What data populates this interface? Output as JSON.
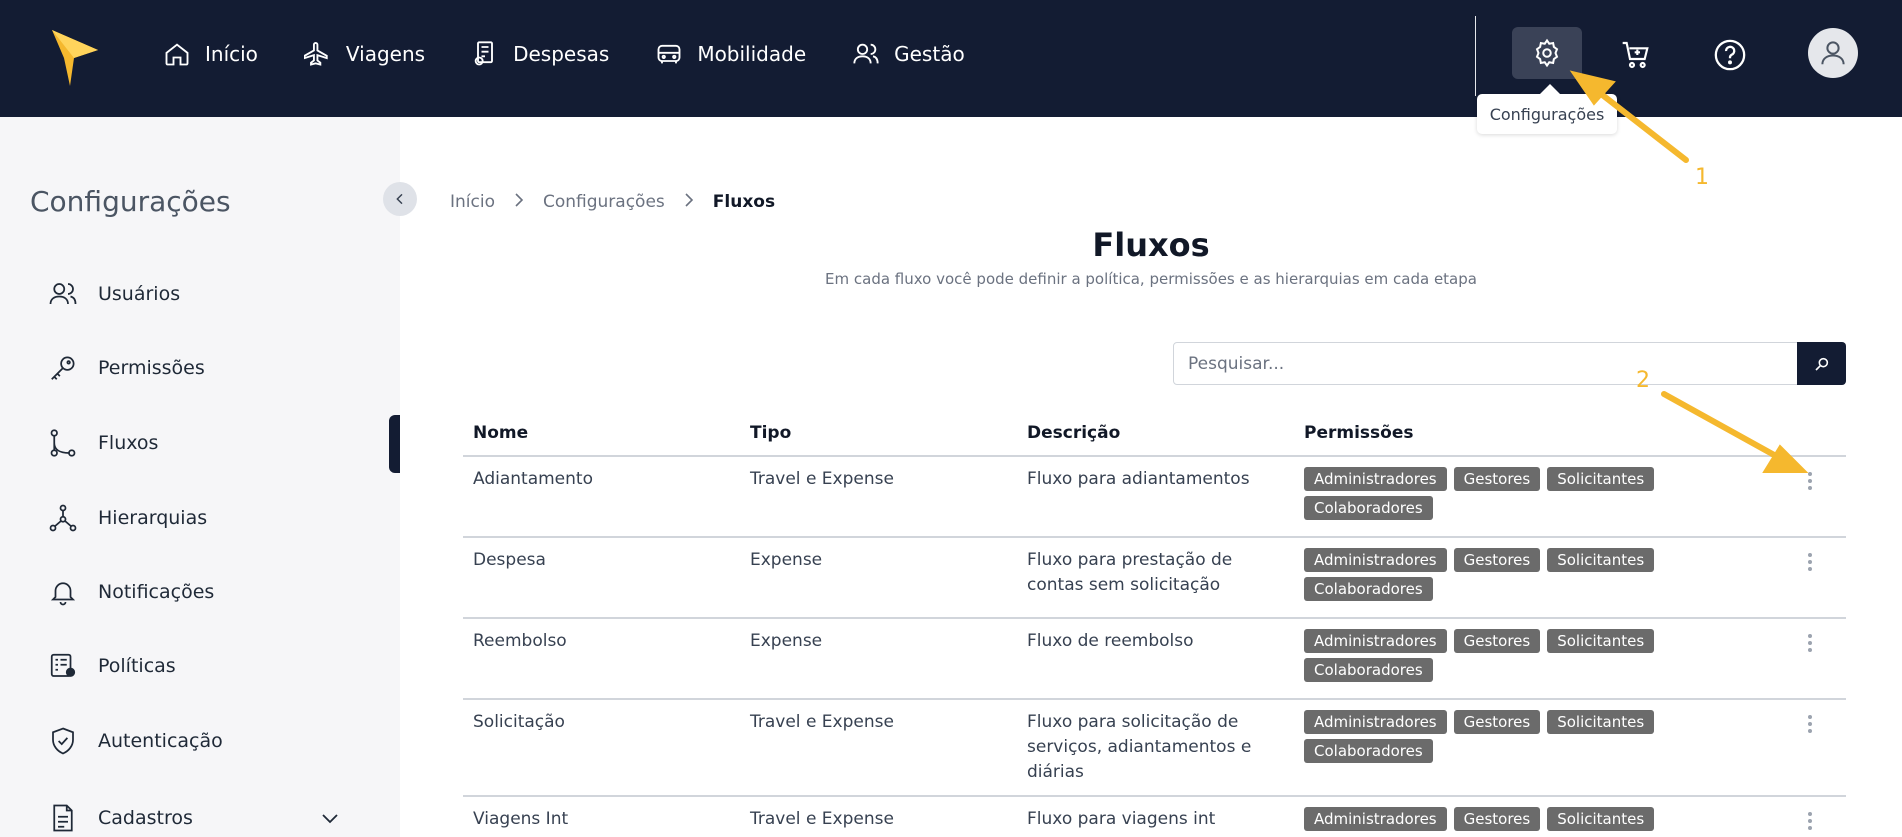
{
  "nav": {
    "items": [
      {
        "label": "Início",
        "icon": "home-icon"
      },
      {
        "label": "Viagens",
        "icon": "airplane-icon"
      },
      {
        "label": "Despesas",
        "icon": "receipt-icon"
      },
      {
        "label": "Mobilidade",
        "icon": "car-icon"
      },
      {
        "label": "Gestão",
        "icon": "users-icon"
      }
    ],
    "tooltip": "Configurações"
  },
  "sidebar": {
    "title": "Configurações",
    "items": [
      {
        "label": "Usuários",
        "icon": "users-icon"
      },
      {
        "label": "Permissões",
        "icon": "key-icon"
      },
      {
        "label": "Fluxos",
        "icon": "flow-icon"
      },
      {
        "label": "Hierarquias",
        "icon": "hierarchy-icon"
      },
      {
        "label": "Notificações",
        "icon": "bell-icon"
      },
      {
        "label": "Políticas",
        "icon": "policy-icon"
      },
      {
        "label": "Autenticação",
        "icon": "shield-icon"
      },
      {
        "label": "Cadastros",
        "icon": "document-icon"
      }
    ]
  },
  "breadcrumb": {
    "items": [
      "Início",
      "Configurações",
      "Fluxos"
    ]
  },
  "page": {
    "title": "Fluxos",
    "subtitle": "Em cada fluxo você pode definir a política, permissões e as hierarquias em cada etapa"
  },
  "search": {
    "placeholder": "Pesquisar..."
  },
  "table": {
    "headers": [
      "Nome",
      "Tipo",
      "Descrição",
      "Permissões"
    ],
    "rows": [
      {
        "nome": "Adiantamento",
        "tipo": "Travel e Expense",
        "descricao": "Fluxo para adiantamentos",
        "permissoes": [
          "Administradores",
          "Gestores",
          "Solicitantes",
          "Colaboradores"
        ]
      },
      {
        "nome": "Despesa",
        "tipo": "Expense",
        "descricao": "Fluxo para prestação de contas sem solicitação",
        "permissoes": [
          "Administradores",
          "Gestores",
          "Solicitantes",
          "Colaboradores"
        ]
      },
      {
        "nome": "Reembolso",
        "tipo": "Expense",
        "descricao": "Fluxo de reembolso",
        "permissoes": [
          "Administradores",
          "Gestores",
          "Solicitantes",
          "Colaboradores"
        ]
      },
      {
        "nome": "Solicitação",
        "tipo": "Travel e Expense",
        "descricao": "Fluxo para solicitação de serviços, adiantamentos e diárias",
        "permissoes": [
          "Administradores",
          "Gestores",
          "Solicitantes",
          "Colaboradores"
        ]
      },
      {
        "nome": "Viagens Int",
        "tipo": "Travel e Expense",
        "descricao": "Fluxo para viagens int",
        "permissoes": [
          "Administradores",
          "Gestores",
          "Solicitantes"
        ]
      }
    ]
  },
  "annotations": {
    "one": "1",
    "two": "2",
    "color": "#f5b82e"
  },
  "colors": {
    "navbar": "#131c33",
    "badge": "#6b6b6b",
    "sidebar": "#f6f6f8"
  }
}
